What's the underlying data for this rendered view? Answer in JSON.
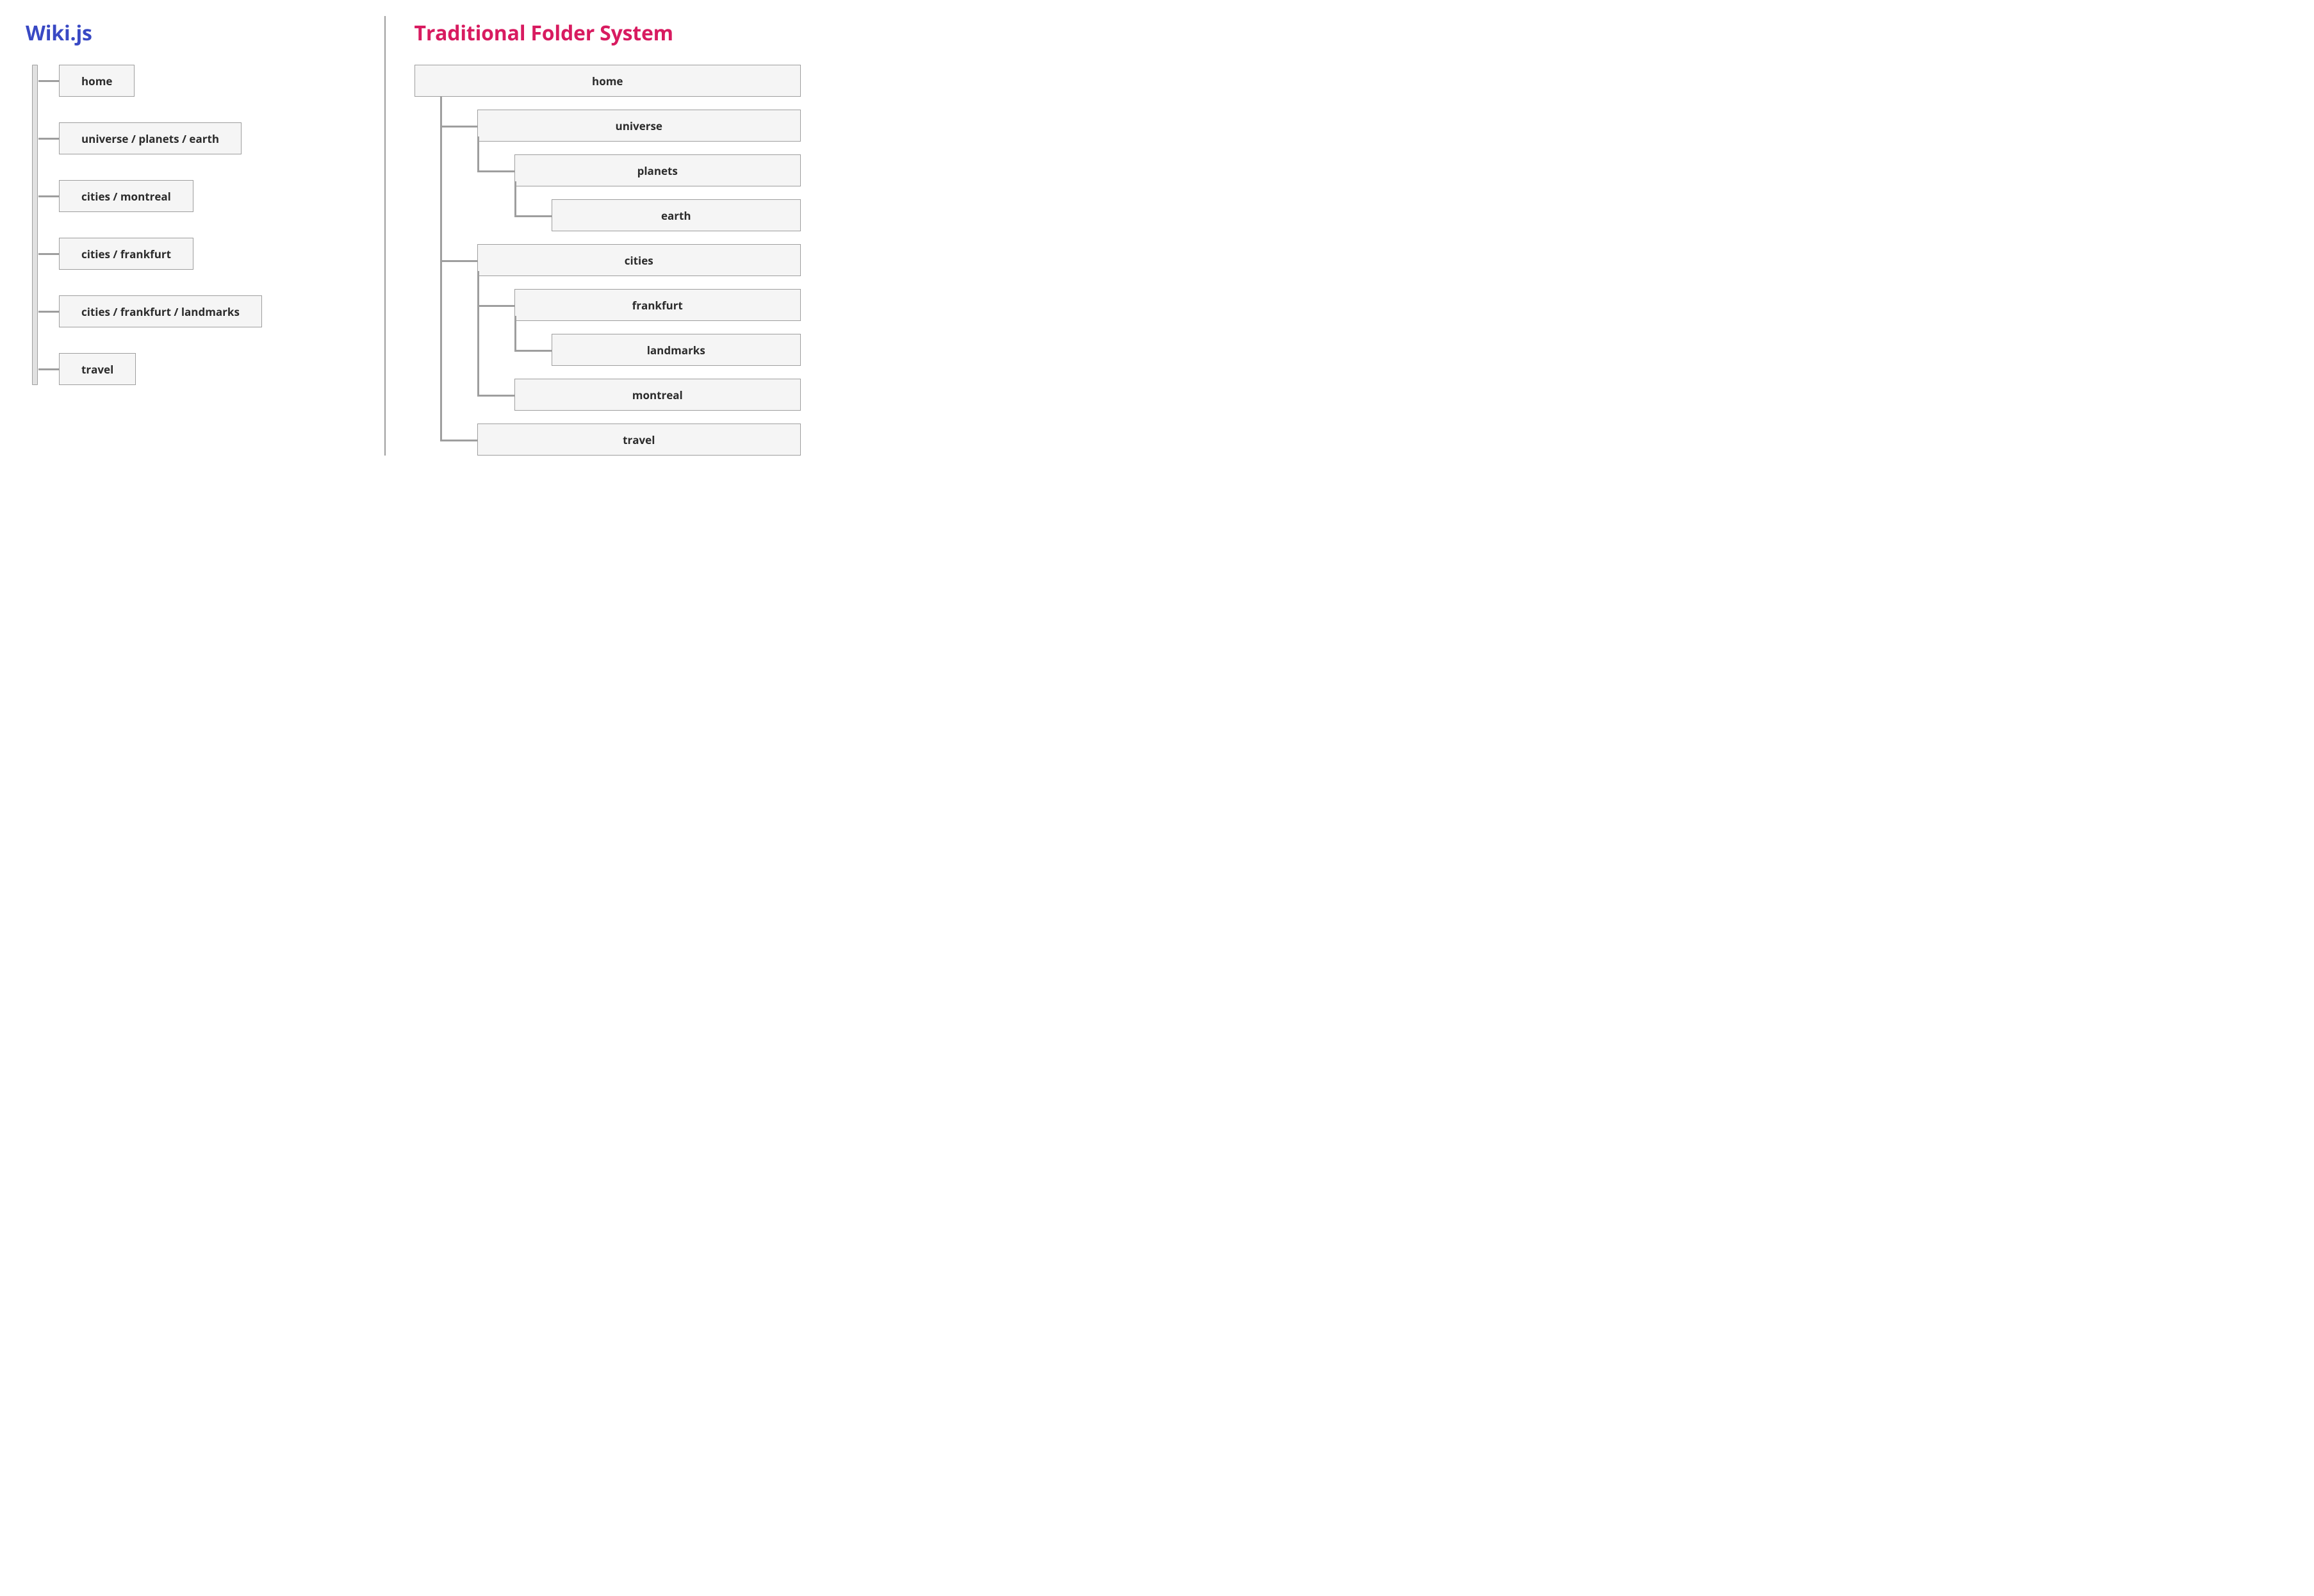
{
  "left": {
    "title": "Wiki.js",
    "items": [
      "home",
      "universe / planets / earth",
      "cities / montreal",
      "cities / frankfurt",
      "cities / frankfurt / landmarks",
      "travel"
    ]
  },
  "right": {
    "title": "Traditional Folder System",
    "root": "home",
    "children": [
      {
        "label": "universe",
        "children": [
          {
            "label": "planets",
            "children": [
              {
                "label": "earth"
              }
            ]
          }
        ]
      },
      {
        "label": "cities",
        "children": [
          {
            "label": "frankfurt",
            "children": [
              {
                "label": "landmarks"
              }
            ]
          },
          {
            "label": "montreal"
          }
        ]
      },
      {
        "label": "travel"
      }
    ]
  },
  "colors": {
    "wikijs_title": "#3949c4",
    "traditional_title": "#d81b60",
    "node_border": "#9e9e9e",
    "node_fill": "#f5f5f5"
  }
}
